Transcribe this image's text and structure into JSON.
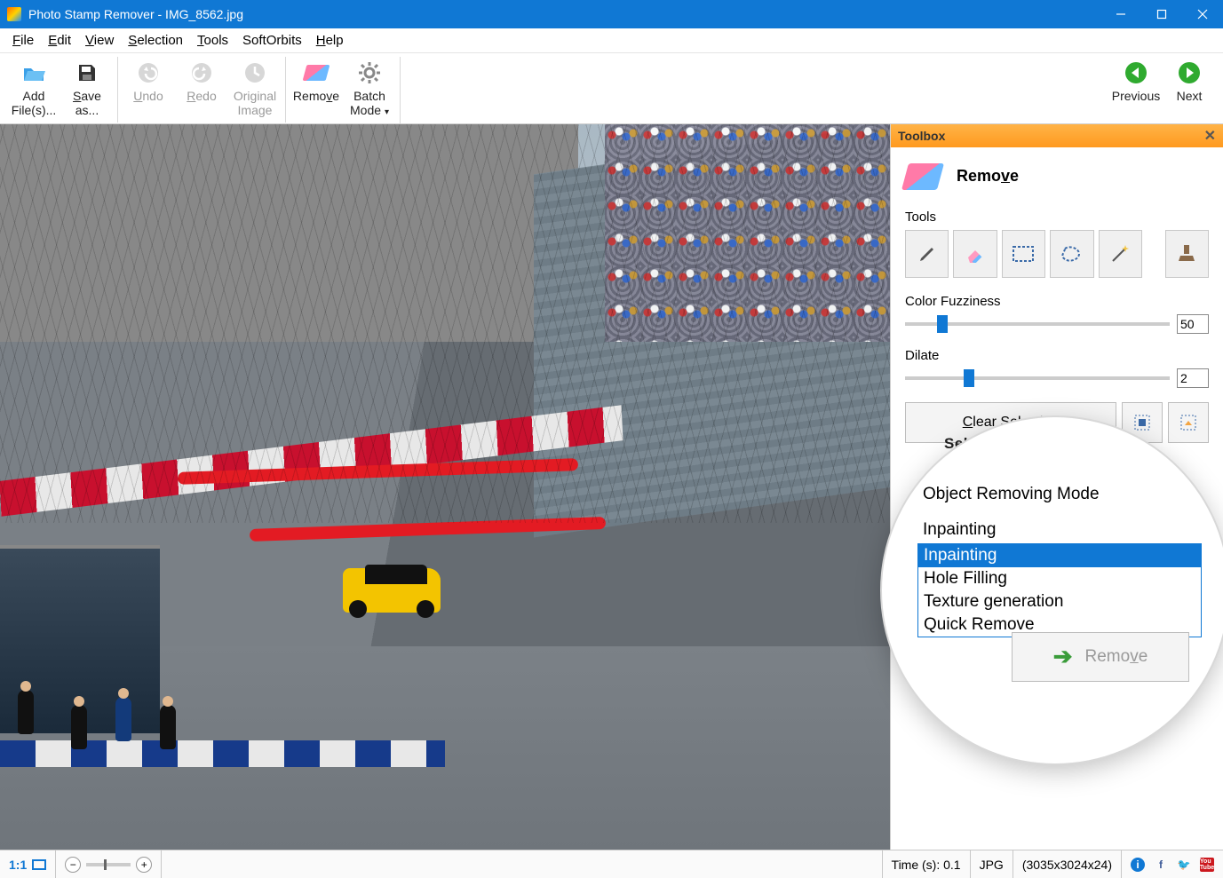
{
  "titlebar": {
    "text": "Photo Stamp Remover - IMG_8562.jpg"
  },
  "menu": {
    "file": "File",
    "edit": "Edit",
    "view": "View",
    "selection": "Selection",
    "tools": "Tools",
    "softorbits": "SoftOrbits",
    "help": "Help"
  },
  "toolbar": {
    "add": "Add File(s)...",
    "save": "Save as...",
    "undo": "Undo",
    "redo": "Redo",
    "original": "Original Image",
    "remove": "Remove",
    "batch": "Batch Mode",
    "previous": "Previous",
    "next": "Next"
  },
  "toolbox": {
    "header": "Toolbox",
    "remove_label": "Remove",
    "tools_label": "Tools",
    "color_fuzziness_label": "Color Fuzziness",
    "color_fuzziness_value": "50",
    "dilate_label": "Dilate",
    "dilate_value": "2",
    "clear_selection": "Clear Selection",
    "select_overlay": "Select"
  },
  "magnifier": {
    "mode_label": "Object Removing Mode",
    "selected": "Inpainting",
    "options": [
      "Inpainting",
      "Hole Filling",
      "Texture generation",
      "Quick Remove"
    ],
    "remove_btn": "Remove"
  },
  "statusbar": {
    "one_to_one": "1:1",
    "time": "Time (s): 0.1",
    "format": "JPG",
    "dimensions": "(3035x3024x24)"
  }
}
